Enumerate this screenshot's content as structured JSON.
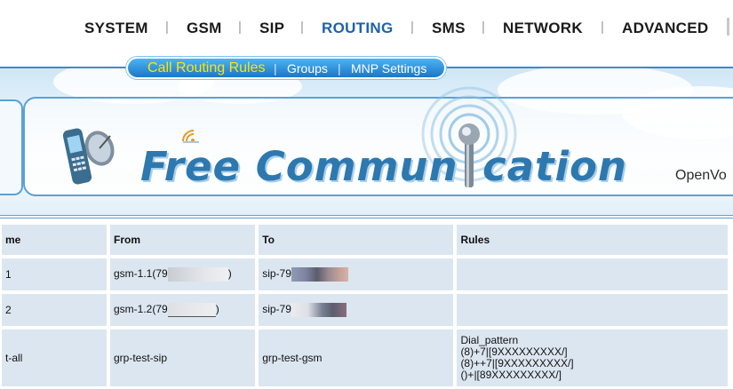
{
  "nav": {
    "items": [
      "SYSTEM",
      "GSM",
      "SIP",
      "ROUTING",
      "SMS",
      "NETWORK",
      "ADVANCED"
    ],
    "active": "ROUTING"
  },
  "subnav": {
    "items": [
      "Call Routing Rules",
      "Groups",
      "MNP Settings"
    ],
    "active": "Call Routing Rules"
  },
  "banner": {
    "title_part1": "Free Commun",
    "title_part2": "cation",
    "sub": "OpenVo"
  },
  "colors": {
    "active_nav": "#1e62a8",
    "subnav_active": "#ffe500",
    "table_cell": "#dce6f0",
    "banner_blue": "#2e78b0"
  },
  "table": {
    "headers": [
      "me",
      "From",
      "To",
      "Rules"
    ],
    "rows": [
      {
        "name": "1",
        "from_prefix": "gsm-1.1(79",
        "from_suffix": ")",
        "to_prefix": "sip-79",
        "rules": []
      },
      {
        "name": "2",
        "from_prefix": "gsm-1.2(79",
        "from_suffix": ")",
        "to_prefix": "sip-79",
        "rules": []
      },
      {
        "name": "t-all",
        "from_prefix": "grp-test-sip",
        "from_suffix": "",
        "to_prefix": "grp-test-gsm",
        "rules": [
          "Dial_pattern",
          "(8)+7|[9XXXXXXXXX/]",
          "(8)++7|[9XXXXXXXXX/]",
          "()+|[89XXXXXXXXX/]"
        ]
      }
    ]
  }
}
